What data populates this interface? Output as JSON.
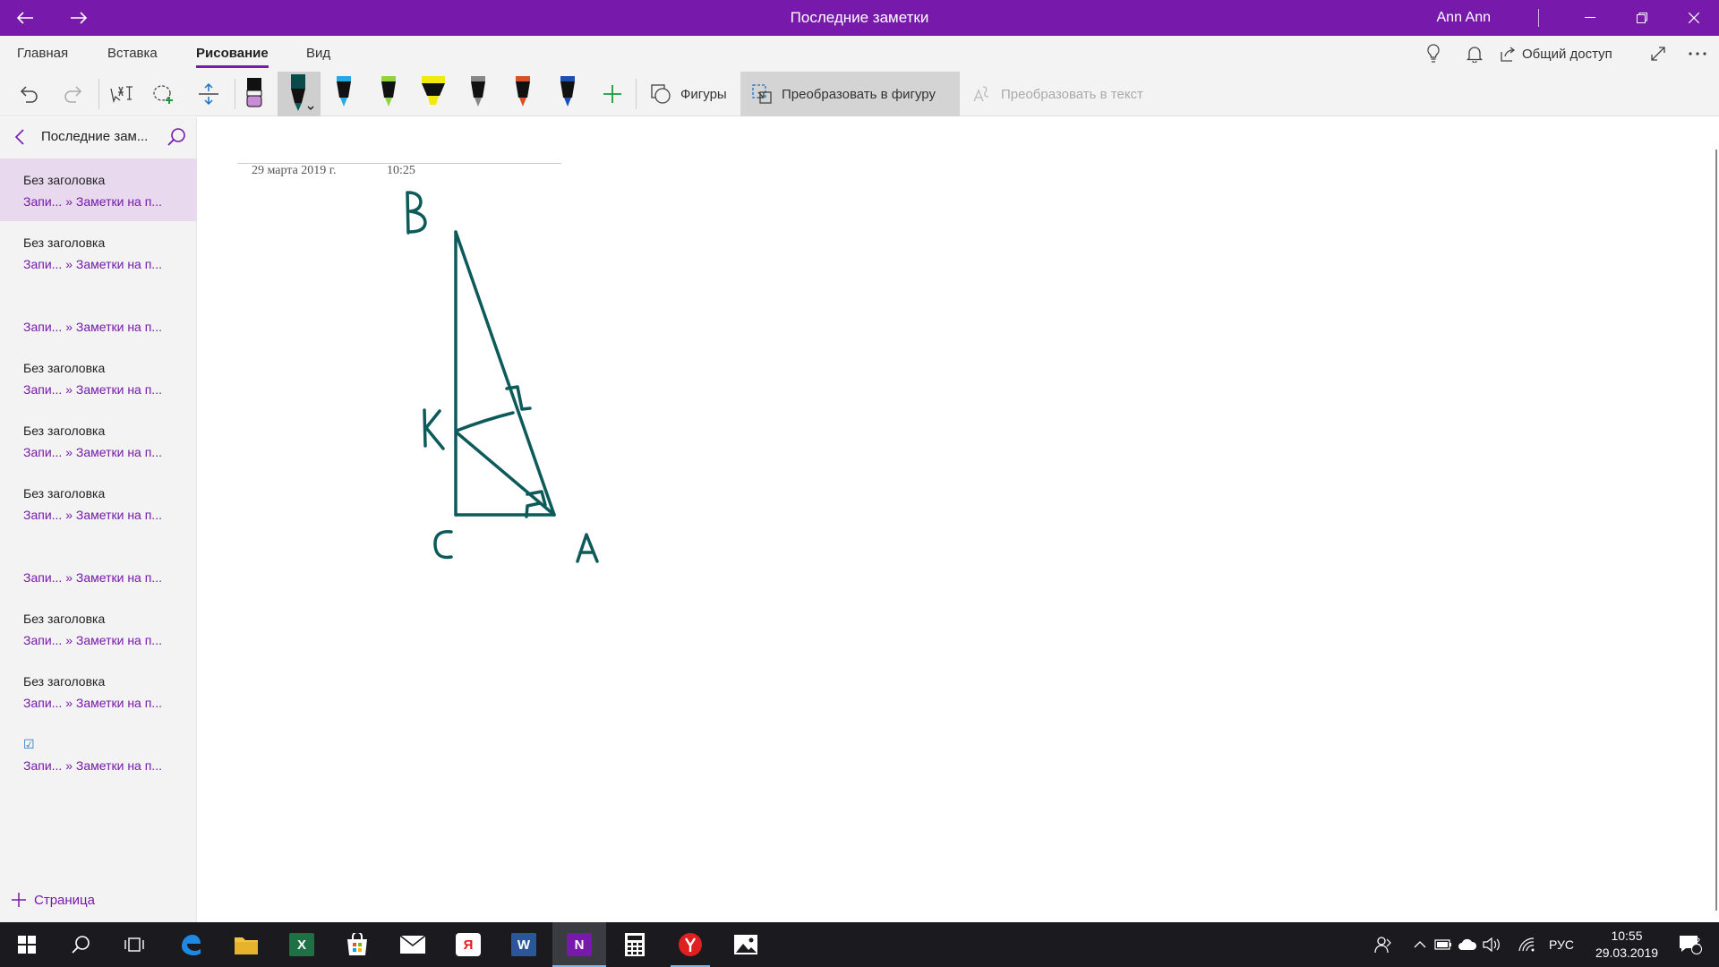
{
  "window": {
    "title": "Последние заметки",
    "user": "Ann Ann"
  },
  "ribbon": {
    "tabs": [
      {
        "label": "Главная"
      },
      {
        "label": "Вставка"
      },
      {
        "label": "Рисование",
        "active": true
      },
      {
        "label": "Вид"
      }
    ],
    "share_label": "Общий доступ"
  },
  "toolbar": {
    "shapes_label": "Фигуры",
    "ink_to_shape_label": "Преобразовать в фигуру",
    "ink_to_text_label": "Преобразовать в текст",
    "pens": [
      {
        "name": "eraser",
        "color": "#c78bd8"
      },
      {
        "name": "selected-pen",
        "color": "#0b4a4a"
      },
      {
        "name": "pen-blue",
        "color": "#29a9e1"
      },
      {
        "name": "pen-green",
        "color": "#8fd33f"
      },
      {
        "name": "highlighter-yellow",
        "color": "#f3e90e"
      },
      {
        "name": "pencil-gray",
        "color": "#888888"
      },
      {
        "name": "pen-galaxy",
        "color": "#d9502a"
      },
      {
        "name": "pen-navy",
        "color": "#1d4fb5"
      }
    ]
  },
  "sidebar": {
    "section_name": "Последние зам...",
    "add_page_label": "Страница",
    "pages": [
      {
        "title": "Без заголовка",
        "subtitle": "Запи... » Заметки на п...",
        "selected": true
      },
      {
        "title": "Без заголовка",
        "subtitle": "Запи... » Заметки на п..."
      },
      {
        "title": "",
        "subtitle": "Запи... » Заметки на п..."
      },
      {
        "title": "Без заголовка",
        "subtitle": "Запи... » Заметки на п..."
      },
      {
        "title": "Без заголовка",
        "subtitle": "Запи... » Заметки на п..."
      },
      {
        "title": "Без заголовка",
        "subtitle": "Запи... » Заметки на п..."
      },
      {
        "title": "",
        "subtitle": "Запи... » Заметки на п..."
      },
      {
        "title": "Без заголовка",
        "subtitle": "Запи... » Заметки на п..."
      },
      {
        "title": "Без заголовка",
        "subtitle": "Запи... » Заметки на п..."
      },
      {
        "title": "☑",
        "subtitle": "Запи... » Заметки на п..."
      }
    ]
  },
  "note": {
    "date": "29 марта 2019 г.",
    "time": "10:25",
    "ink_color": "#0d5a5a",
    "ink_labels": {
      "b": "B",
      "k": "K",
      "c": "C",
      "a": "A"
    }
  },
  "taskbar": {
    "apps": [
      "start",
      "search",
      "task-view",
      "edge",
      "explorer",
      "excel",
      "store",
      "mail",
      "yandex-browser",
      "word",
      "onenote",
      "calculator",
      "yandex",
      "photos"
    ],
    "language": "РУС",
    "time": "10:55",
    "date": "29.03.2019",
    "notifications_count": "2"
  }
}
